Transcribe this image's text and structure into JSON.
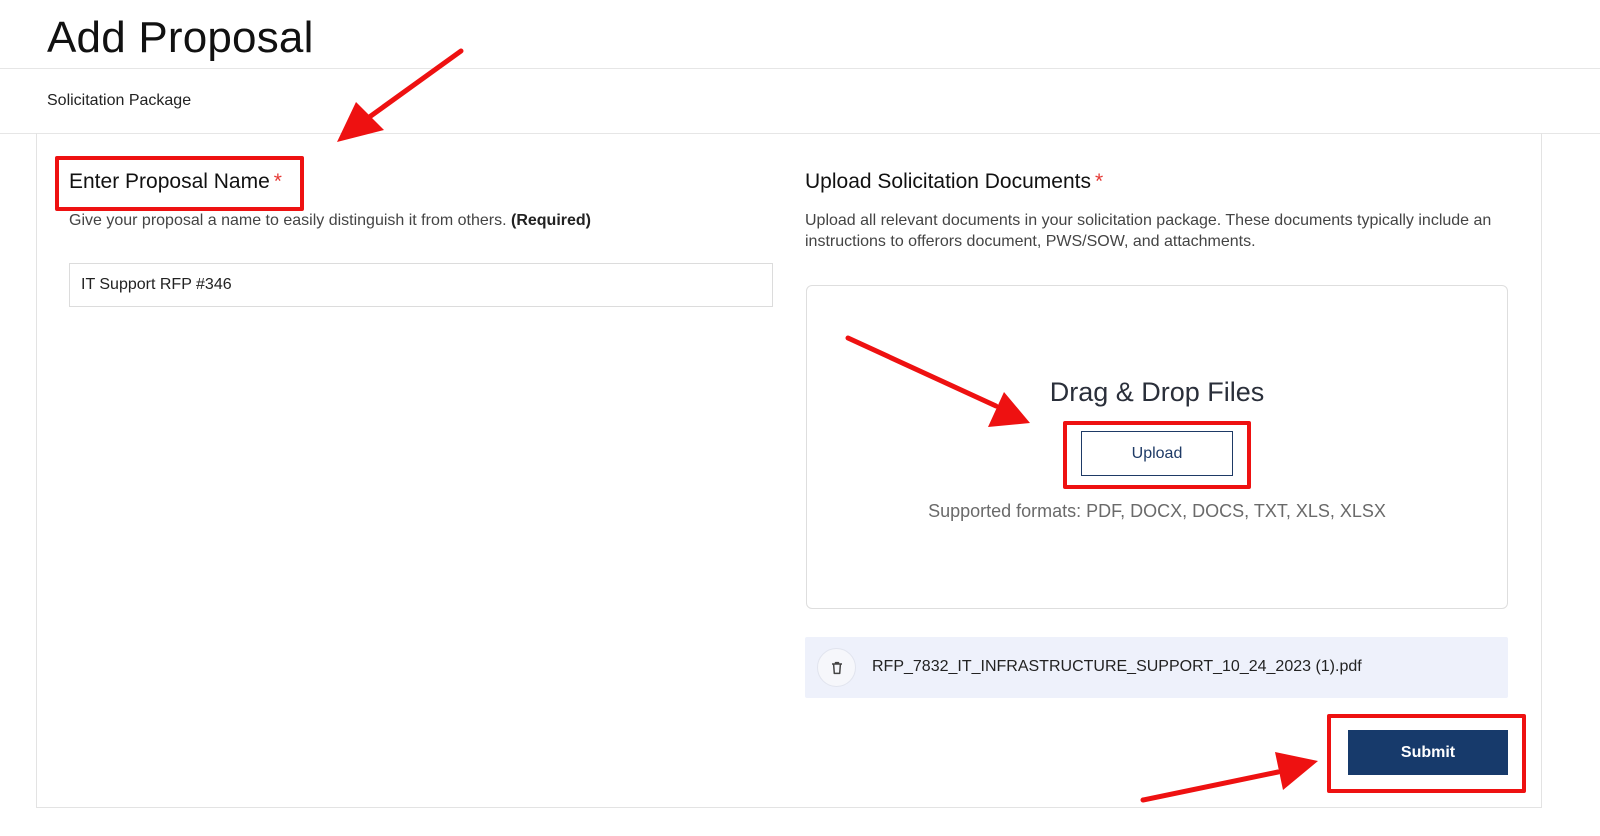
{
  "page": {
    "title": "Add Proposal",
    "subnav_label": "Solicitation Package"
  },
  "proposal_name": {
    "title": "Enter Proposal Name",
    "required_mark": "*",
    "description": "Give your proposal a name to easily distinguish it from others.",
    "description_required": "(Required)",
    "value": "IT Support RFP #346"
  },
  "upload": {
    "title": "Upload Solicitation Documents",
    "required_mark": "*",
    "description": "Upload all relevant documents in your solicitation package. These documents typically include an instructions to offerors document, PWS/SOW, and attachments.",
    "drop_title": "Drag & Drop Files",
    "button_label": "Upload",
    "formats": "Supported formats: PDF, DOCX, DOCS, TXT, XLS, XLSX",
    "files": [
      {
        "name": "RFP_7832_IT_INFRASTRUCTURE_SUPPORT_10_24_2023 (1).pdf",
        "icon": "trash-icon"
      }
    ]
  },
  "actions": {
    "submit_label": "Submit"
  },
  "colors": {
    "primary": "#173a6b",
    "required": "#e53935",
    "annotation": "#ee1111",
    "file_row_bg": "#eef1fb"
  }
}
